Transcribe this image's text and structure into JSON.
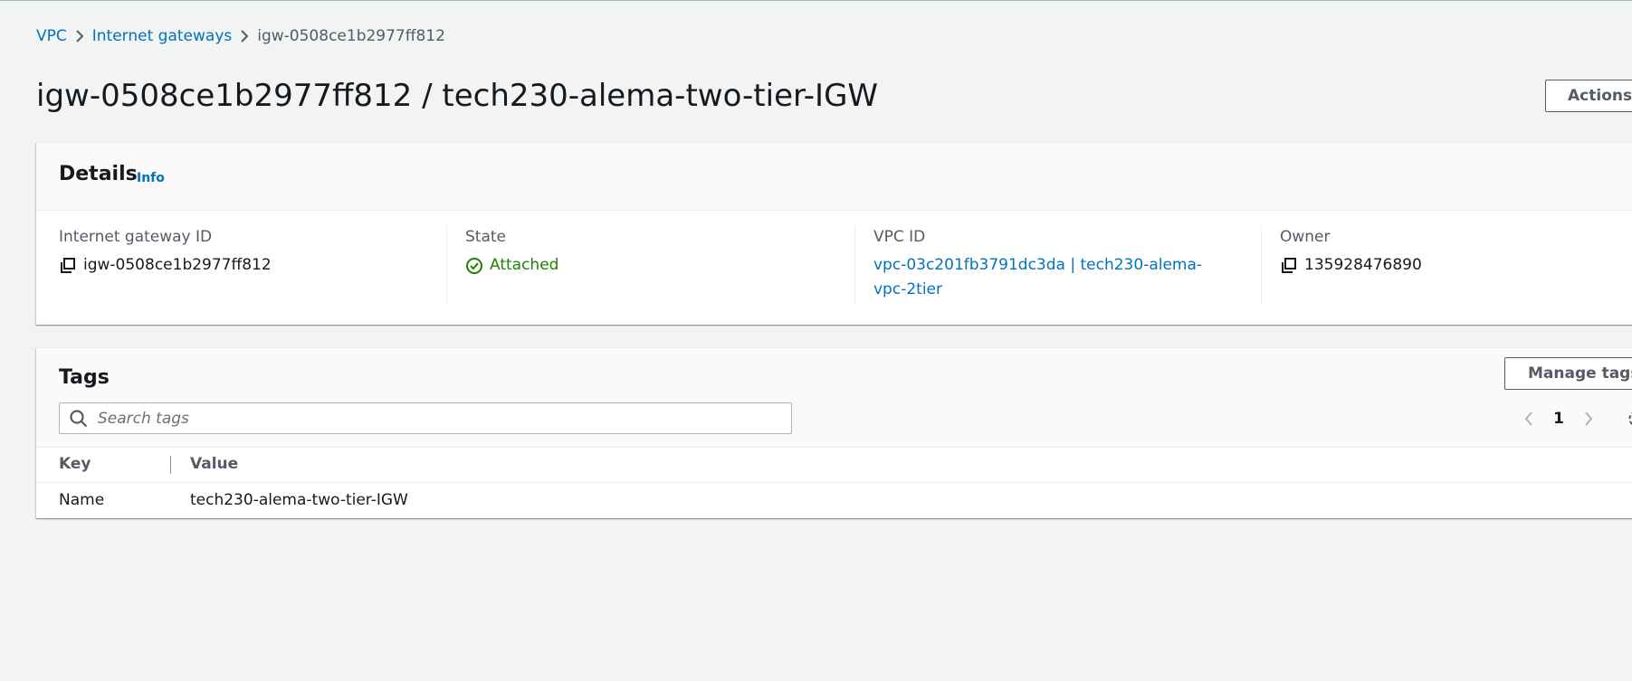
{
  "breadcrumb": {
    "items": [
      "VPC",
      "Internet gateways"
    ],
    "current": "igw-0508ce1b2977ff812"
  },
  "page": {
    "title": "igw-0508ce1b2977ff812 / tech230-alema-two-tier-IGW",
    "actions_label": "Actions"
  },
  "details": {
    "title": "Details",
    "info_label": "Info",
    "fields": {
      "igw_id": {
        "label": "Internet gateway ID",
        "value": "igw-0508ce1b2977ff812",
        "icon": "copy-icon"
      },
      "state": {
        "label": "State",
        "value": "Attached",
        "icon": "check-circle-icon",
        "color": "#1d8102"
      },
      "vpc_id": {
        "label": "VPC ID",
        "value": "vpc-03c201fb3791dc3da | tech230-alema-vpc-2tier"
      },
      "owner": {
        "label": "Owner",
        "value": "135928476890",
        "icon": "copy-icon"
      }
    }
  },
  "tags": {
    "title": "Tags",
    "manage_label": "Manage tags",
    "search_placeholder": "Search tags",
    "pager_page": "1",
    "columns": {
      "key": "Key",
      "value": "Value"
    },
    "rows": [
      {
        "key": "Name",
        "value": "tech230-alema-two-tier-IGW"
      }
    ]
  },
  "colors": {
    "link": "#0073bb",
    "background": "#f2f3f3",
    "success": "#1d8102"
  }
}
